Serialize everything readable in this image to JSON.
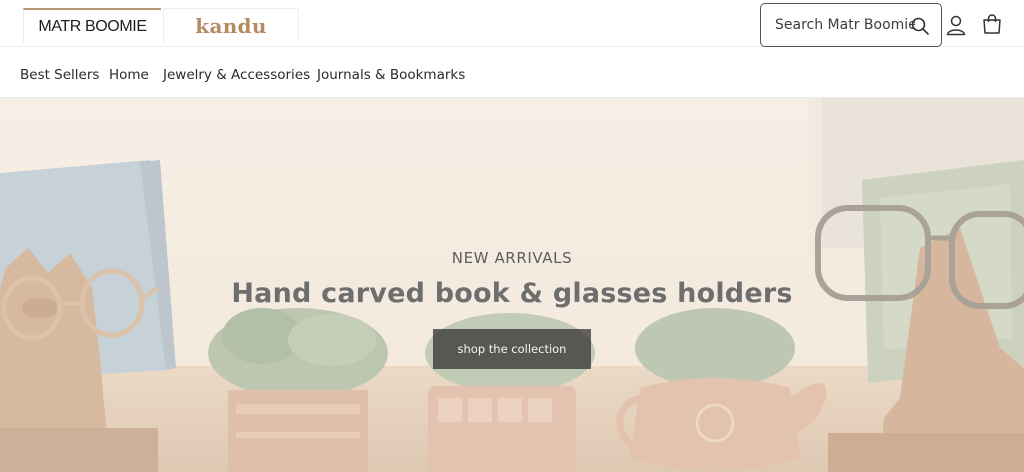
{
  "header": {
    "brands": [
      {
        "label": "MATR BOOMIE"
      },
      {
        "label": "kandu"
      }
    ],
    "search": {
      "placeholder": "Search Matr Boomie"
    },
    "icons": [
      "search-icon",
      "account-icon",
      "cart-icon"
    ]
  },
  "nav": {
    "items": [
      {
        "label": "Best Sellers"
      },
      {
        "label": "Home"
      },
      {
        "label": "Jewelry & Accessories"
      },
      {
        "label": "Journals & Bookmarks"
      }
    ]
  },
  "hero": {
    "eyebrow": "NEW ARRIVALS",
    "title": "Hand carved book & glasses holders",
    "cta_label": "shop the collection"
  },
  "colors": {
    "brand_accent": "#b48c62",
    "hero_background": "#efe3d6",
    "cta_background": "#2d2d2d"
  }
}
